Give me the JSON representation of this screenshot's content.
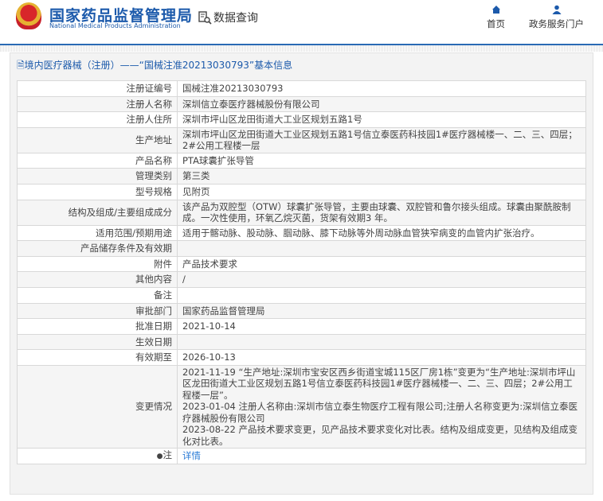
{
  "header": {
    "logo_cn": "国家药品监督管理局",
    "logo_en": "National Medical Products Administration",
    "query": "数据查询",
    "nav": [
      {
        "label": "首页",
        "icon": "home-icon"
      },
      {
        "label": "政务服务门户",
        "icon": "user-icon"
      }
    ]
  },
  "panel": {
    "title": "境内医疗器械（注册）——“国械注准20213030793”基本信息"
  },
  "rows": [
    {
      "k": "注册证编号",
      "v": "国械注准20213030793"
    },
    {
      "k": "注册人名称",
      "v": "深圳信立泰医疗器械股份有限公司"
    },
    {
      "k": "注册人住所",
      "v": "深圳市坪山区龙田街道大工业区规划五路1号"
    },
    {
      "k": "生产地址",
      "v": "深圳市坪山区龙田街道大工业区规划五路1号信立泰医药科技园1#医疗器械楼一、二、三、四层；2#公用工程楼一层"
    },
    {
      "k": "产品名称",
      "v": "PTA球囊扩张导管"
    },
    {
      "k": "管理类别",
      "v": "第三类"
    },
    {
      "k": "型号规格",
      "v": "见附页"
    },
    {
      "k": "结构及组成/主要组成成分",
      "v": "该产品为双腔型（OTW）球囊扩张导管，主要由球囊、双腔管和鲁尔接头组成。球囊由聚酰胺制成。一次性使用，环氧乙烷灭菌，货架有效期3 年。"
    },
    {
      "k": "适用范围/预期用途",
      "v": "适用于髂动脉、股动脉、腘动脉、膝下动脉等外周动脉血管狭窄病变的血管内扩张治疗。"
    },
    {
      "k": "产品储存条件及有效期",
      "v": ""
    },
    {
      "k": "附件",
      "v": "产品技术要求"
    },
    {
      "k": "其他内容",
      "v": "/"
    },
    {
      "k": "备注",
      "v": ""
    },
    {
      "k": "审批部门",
      "v": "国家药品监督管理局"
    },
    {
      "k": "批准日期",
      "v": "2021-10-14"
    },
    {
      "k": "生效日期",
      "v": ""
    },
    {
      "k": "有效期至",
      "v": "2026-10-13"
    },
    {
      "k": "变更情况",
      "v": [
        "2021-11-19 “生产地址:深圳市宝安区西乡街道宝城115区厂房1栋”变更为“生产地址:深圳市坪山区龙田街道大工业区规划五路1号信立泰医药科技园1#医疗器械楼一、二、三、四层；2#公用工程楼一层”。",
        "2023-01-04 注册人名称由:深圳市信立泰生物医疗工程有限公司;注册人名称变更为:深圳信立泰医疗器械股份有限公司",
        "2023-08-22 产品技术要求变更，见产品技术要求变化对比表。结构及组成变更，见结构及组成变化对比表。"
      ]
    }
  ],
  "note": {
    "label": "注",
    "link": "详情"
  }
}
